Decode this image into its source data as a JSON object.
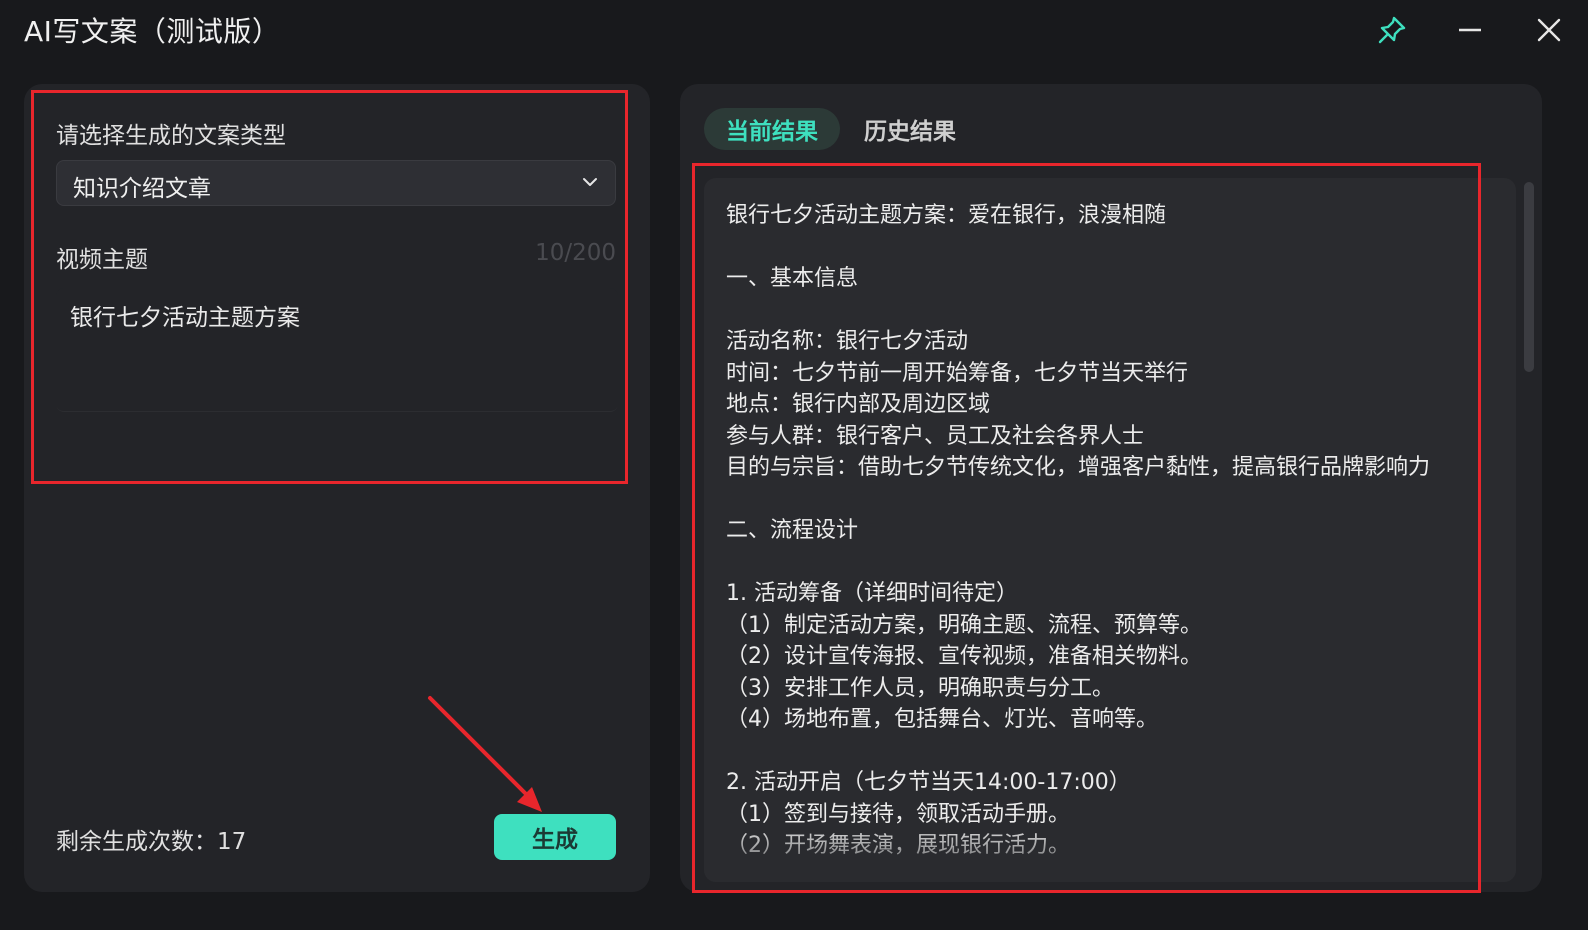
{
  "window": {
    "title": "AI写文案（测试版）",
    "accent_color": "#3ee0bf",
    "annotation_color": "#e8262c"
  },
  "left": {
    "type_label": "请选择生成的文案类型",
    "type_selected": "知识介绍文章",
    "topic_label": "视频主题",
    "topic_counter": "10/200",
    "topic_value": "银行七夕活动主题方案",
    "remaining": "剩余生成次数：17",
    "generate_label": "生成"
  },
  "right": {
    "tabs": [
      {
        "label": "当前结果",
        "active": true
      },
      {
        "label": "历史结果",
        "active": false
      }
    ],
    "lines": [
      "银行七夕活动主题方案：爱在银行，浪漫相随",
      "",
      "一、基本信息",
      "",
      "活动名称：银行七夕活动",
      "时间：七夕节前一周开始筹备，七夕节当天举行",
      "地点：银行内部及周边区域",
      "参与人群：银行客户、员工及社会各界人士",
      "目的与宗旨：借助七夕节传统文化，增强客户黏性，提高银行品牌影响力",
      "",
      "二、流程设计",
      "",
      "1. 活动筹备（详细时间待定）",
      "（1）制定活动方案，明确主题、流程、预算等。",
      "（2）设计宣传海报、宣传视频，准备相关物料。",
      "（3）安排工作人员，明确职责与分工。",
      "（4）场地布置，包括舞台、灯光、音响等。",
      "",
      "2. 活动开启（七夕节当天14:00-17:00）",
      "（1）签到与接待，领取活动手册。",
      "（2）开场舞表演，展现银行活力。"
    ]
  },
  "icons": {
    "pin": "pin-icon",
    "minimize": "minimize-icon",
    "close": "close-icon",
    "chevron": "chevron-down-icon"
  }
}
